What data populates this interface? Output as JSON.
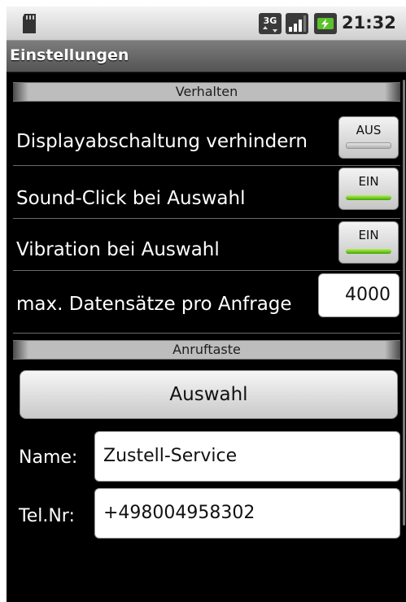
{
  "status_bar": {
    "time": "21:32",
    "network": "3G",
    "icons": [
      "sd-card-icon",
      "3g-data-icon",
      "signal-icon",
      "battery-charging-icon"
    ]
  },
  "title_bar": {
    "title": "Einstellungen"
  },
  "sections": {
    "behavior": {
      "header": "Verhalten"
    },
    "call_key": {
      "header": "Anruftaste"
    }
  },
  "settings": [
    {
      "label": "Displayabschaltung verhindern",
      "toggle": "AUS",
      "on": false
    },
    {
      "label": "Sound-Click bei Auswahl",
      "toggle": "EIN",
      "on": true
    },
    {
      "label": "Vibration bei Auswahl",
      "toggle": "EIN",
      "on": true
    }
  ],
  "max_records": {
    "label": "max. Datensätze pro Anfrage",
    "value": "4000"
  },
  "call": {
    "select_button": "Auswahl",
    "name_label": "Name:",
    "name_value": "Zustell-Service",
    "phone_label": "Tel.Nr:",
    "phone_value": "+498004958302"
  },
  "colors": {
    "background": "#000000",
    "toggle_on": "#3fa600",
    "section_header": "#bdbdbd"
  }
}
